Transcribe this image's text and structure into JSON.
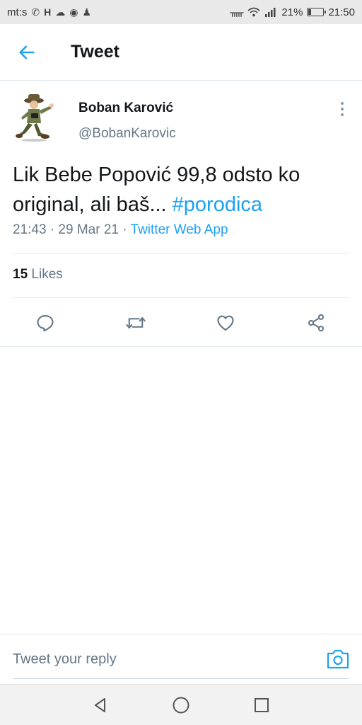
{
  "status_bar": {
    "carrier": "mt:s",
    "left_icons": [
      "phone-icon",
      "h-icon",
      "cloud-icon",
      "chrome-icon",
      "person-icon"
    ],
    "battery_percent_text": "21%",
    "battery_level": 0.21,
    "time": "21:50",
    "right_icons": [
      "bluetooth-icon",
      "wifi-icon",
      "signal-icon",
      "battery-icon"
    ]
  },
  "header": {
    "title": "Tweet",
    "back_icon": "arrow-left-icon"
  },
  "tweet": {
    "author_name": "Boban Karović",
    "author_handle": "@BobanKarovic",
    "text": "Lik Bebe Popović 99,8 odsto ko original, ali baš... ",
    "hashtag": "#porodica",
    "timestamp": "21:43 · 29 Mar 21 · ",
    "source": "Twitter Web App",
    "likes_count": "15",
    "likes_label": " Likes"
  },
  "actions": [
    "reply-icon",
    "retweet-icon",
    "like-icon",
    "share-icon"
  ],
  "reply": {
    "placeholder": "Tweet your reply",
    "camera_icon": "camera-icon"
  },
  "nav": [
    "back-triangle-icon",
    "home-circle-icon",
    "recents-square-icon"
  ],
  "colors": {
    "accent": "#1da1f2",
    "secondary_text": "#657786",
    "divider": "#e1e8ed"
  }
}
